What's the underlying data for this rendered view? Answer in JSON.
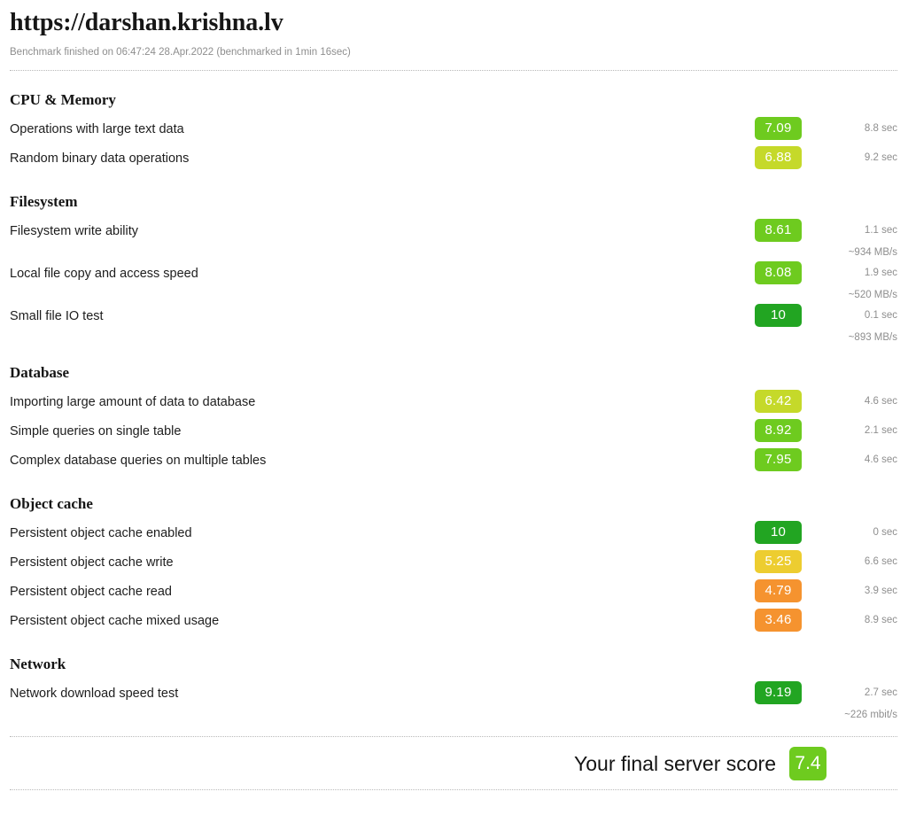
{
  "header": {
    "title": "https://darshan.krishna.lv",
    "meta": "Benchmark finished on 06:47:24 28.Apr.2022 (benchmarked in 1min 16sec)"
  },
  "colors": {
    "score_dark_green": "#22a522",
    "score_green": "#6ecb1f",
    "score_yellow_green": "#c5d92a",
    "score_yellow": "#edcd30",
    "score_orange": "#f5932f",
    "muted_text": "#8e8e8e",
    "divider": "#b9b9b9"
  },
  "sections": [
    {
      "title": "CPU & Memory",
      "rows": [
        {
          "label": "Operations with large text data",
          "score": "7.09",
          "color": "#6ecb1f",
          "stat": "8.8 sec",
          "stat_sub": ""
        },
        {
          "label": "Random binary data operations",
          "score": "6.88",
          "color": "#c5d92a",
          "stat": "9.2 sec",
          "stat_sub": ""
        }
      ]
    },
    {
      "title": "Filesystem",
      "rows": [
        {
          "label": "Filesystem write ability",
          "score": "8.61",
          "color": "#6ecb1f",
          "stat": "1.1 sec",
          "stat_sub": "~934 MB/s"
        },
        {
          "label": "Local file copy and access speed",
          "score": "8.08",
          "color": "#6ecb1f",
          "stat": "1.9 sec",
          "stat_sub": "~520 MB/s"
        },
        {
          "label": "Small file IO test",
          "score": "10",
          "color": "#22a522",
          "stat": "0.1 sec",
          "stat_sub": "~893 MB/s"
        }
      ]
    },
    {
      "title": "Database",
      "rows": [
        {
          "label": "Importing large amount of data to database",
          "score": "6.42",
          "color": "#c5d92a",
          "stat": "4.6 sec",
          "stat_sub": ""
        },
        {
          "label": "Simple queries on single table",
          "score": "8.92",
          "color": "#6ecb1f",
          "stat": "2.1 sec",
          "stat_sub": ""
        },
        {
          "label": "Complex database queries on multiple tables",
          "score": "7.95",
          "color": "#6ecb1f",
          "stat": "4.6 sec",
          "stat_sub": ""
        }
      ]
    },
    {
      "title": "Object cache",
      "rows": [
        {
          "label": "Persistent object cache enabled",
          "score": "10",
          "color": "#22a522",
          "stat": "0 sec",
          "stat_sub": ""
        },
        {
          "label": "Persistent object cache write",
          "score": "5.25",
          "color": "#edcd30",
          "stat": "6.6 sec",
          "stat_sub": ""
        },
        {
          "label": "Persistent object cache read",
          "score": "4.79",
          "color": "#f5932f",
          "stat": "3.9 sec",
          "stat_sub": ""
        },
        {
          "label": "Persistent object cache mixed usage",
          "score": "3.46",
          "color": "#f5932f",
          "stat": "8.9 sec",
          "stat_sub": ""
        }
      ]
    },
    {
      "title": "Network",
      "rows": [
        {
          "label": "Network download speed test",
          "score": "9.19",
          "color": "#22a522",
          "stat": "2.7 sec",
          "stat_sub": "~226 mbit/s"
        }
      ]
    }
  ],
  "final": {
    "label": "Your final server score",
    "score": "7.4",
    "color": "#6ecb1f"
  }
}
